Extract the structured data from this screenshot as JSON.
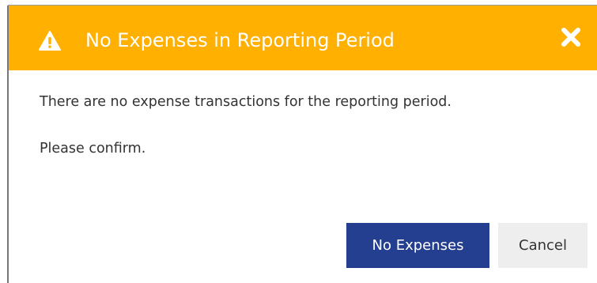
{
  "dialog": {
    "title": "No Expenses in Reporting Period",
    "message": "There are no expense transactions for the reporting period.",
    "confirm_prompt": "Please confirm.",
    "primary_button_label": "No Expenses",
    "secondary_button_label": "Cancel",
    "icons": {
      "header": "warning-icon",
      "close": "close-icon"
    },
    "colors": {
      "header_background": "#ffb000",
      "primary_button": "#243f8f",
      "secondary_button": "#eeeeee"
    }
  }
}
